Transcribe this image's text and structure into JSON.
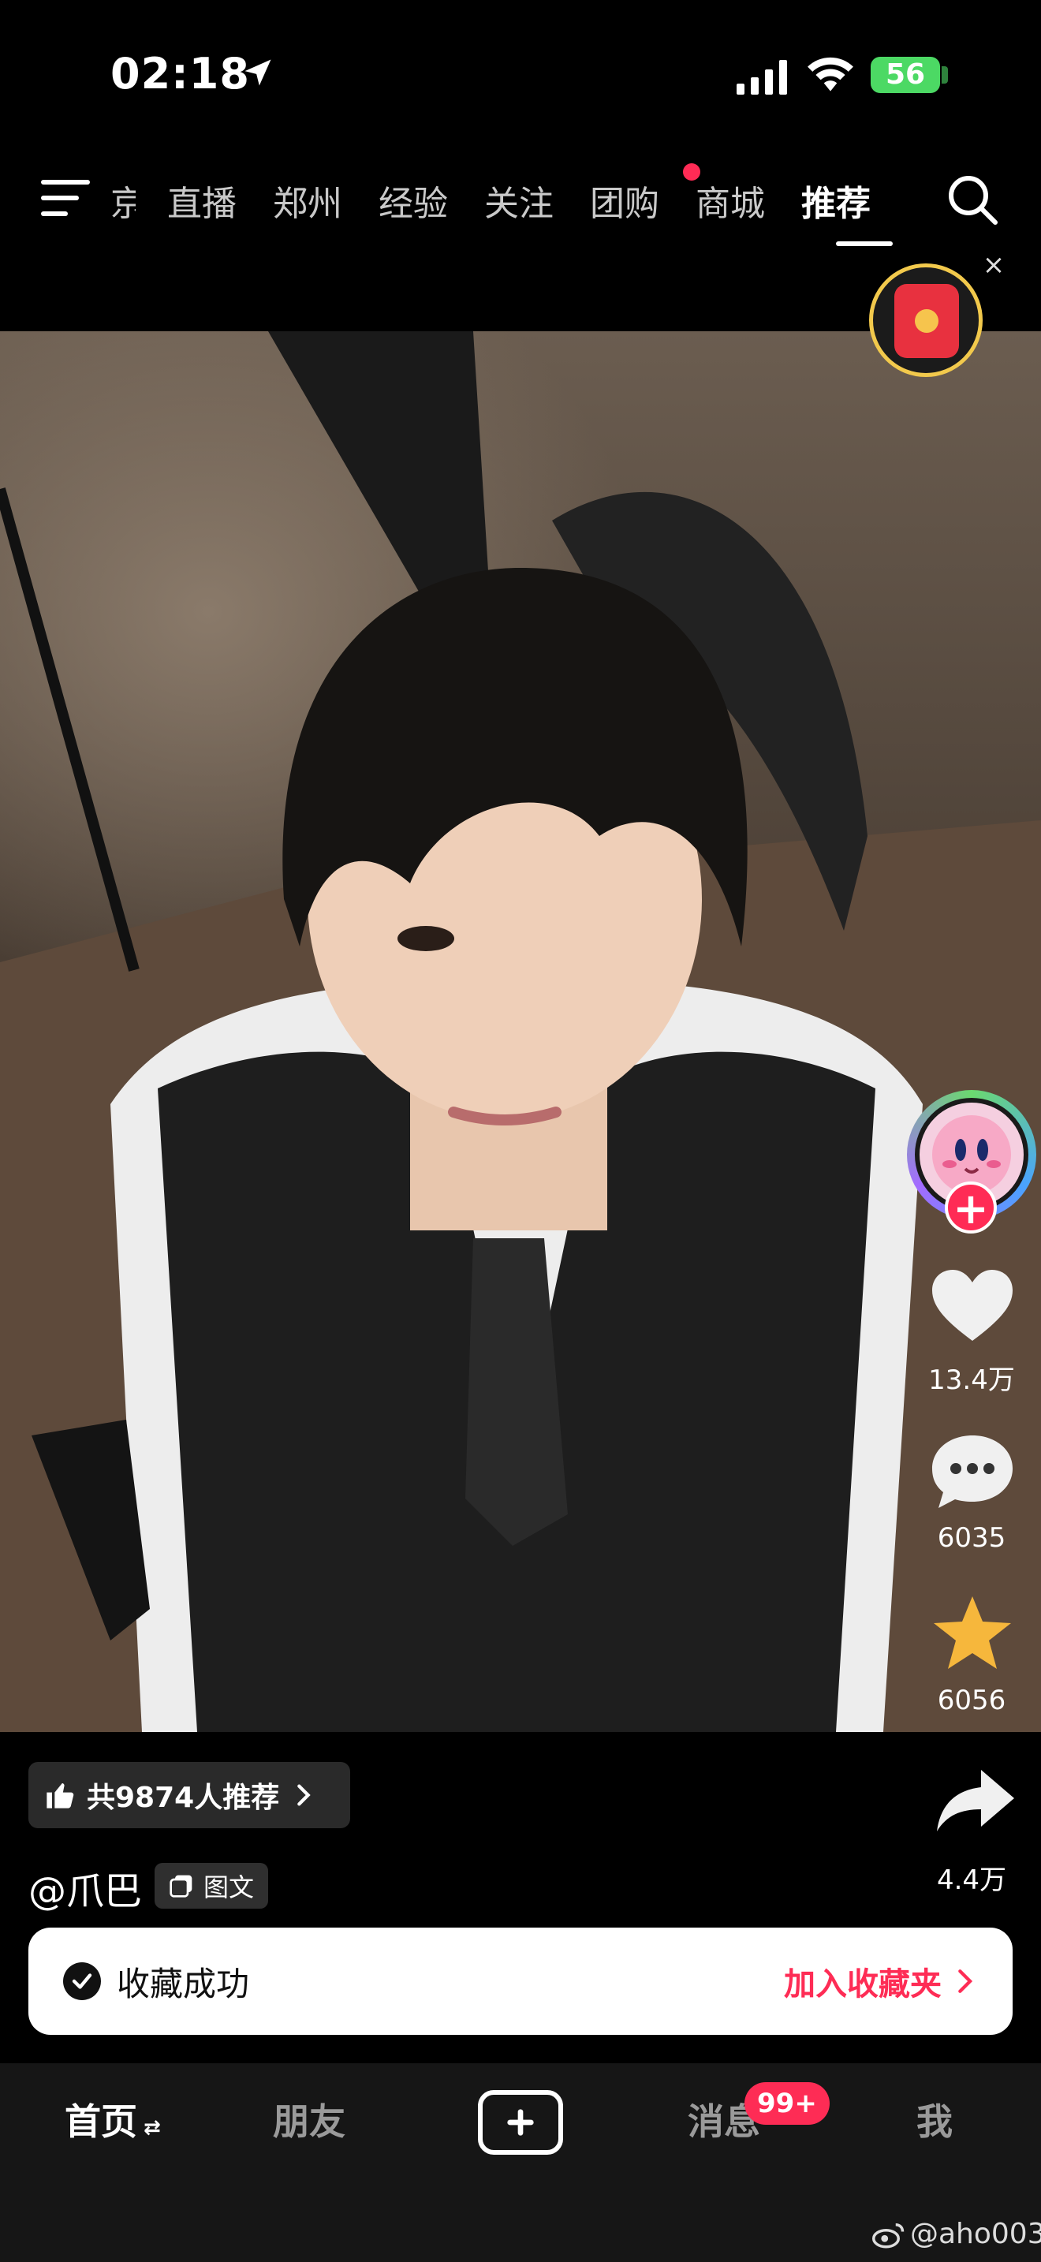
{
  "status_bar": {
    "time": "02:18",
    "battery": "56"
  },
  "top_nav": {
    "items": [
      {
        "label": "京",
        "partial": true
      },
      {
        "label": "直播"
      },
      {
        "label": "郑州"
      },
      {
        "label": "经验"
      },
      {
        "label": "关注"
      },
      {
        "label": "团购",
        "dot": true
      },
      {
        "label": "商城"
      },
      {
        "label": "推荐",
        "active": true
      }
    ]
  },
  "red_packet": {
    "close": "×"
  },
  "actions": {
    "follow": "+",
    "likes": "13.4万",
    "comments": "6035",
    "favorites": "6056",
    "shares": "4.4万"
  },
  "post": {
    "recommend": "共9874人推荐",
    "username": "@爪巴",
    "type_badge": "图文"
  },
  "toast": {
    "message": "收藏成功",
    "action": "加入收藏夹"
  },
  "tabbar": {
    "home": "首页",
    "friends": "朋友",
    "messages": "消息",
    "messages_badge": "99+",
    "me": "我"
  },
  "watermark": "@aho003",
  "colors": {
    "accent": "#fe2c55",
    "star": "#f6b73c",
    "battery": "#4cd964"
  }
}
